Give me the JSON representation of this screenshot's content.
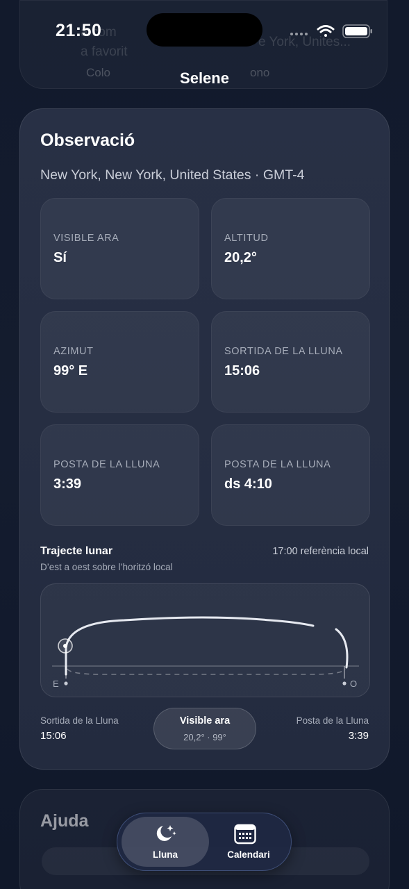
{
  "background_card": {
    "text_a": "a com",
    "text_b": "a favorit",
    "text_c": "e York, Unites..."
  },
  "status_bar": {
    "time": "21:50"
  },
  "nav": {
    "title": "Selene"
  },
  "observation": {
    "title": "Observació",
    "location": "New York, New York, United States · GMT-4",
    "tiles": [
      {
        "label": "VISIBLE ARA",
        "value": "Sí"
      },
      {
        "label": "ALTITUD",
        "value": "20,2°"
      },
      {
        "label": "AZIMUT",
        "value": "99° E"
      },
      {
        "label": "SORTIDA DE LA LLUNA",
        "value": "15:06"
      },
      {
        "label": "POSTA DE LA LLUNA",
        "value": "3:39"
      },
      {
        "label": "POSTA DE LA LLUNA",
        "value": "ds 4:10"
      }
    ],
    "path": {
      "title": "Trajecte lunar",
      "subtitle": "D’est a oest sobre l’horitzó local",
      "reference": "17:00 referència local",
      "east_label": "E",
      "west_label": "O"
    },
    "footer": {
      "rise_label": "Sortida de la Lluna",
      "rise_value": "15:06",
      "now_title": "Visible ara",
      "now_sub": "20,2° · 99°",
      "set_label": "Posta de la Lluna",
      "set_value": "3:39"
    }
  },
  "help": {
    "title": "Ajuda",
    "left_text": "Colo",
    "right_text": "ono"
  },
  "tabbar": {
    "tabs": [
      {
        "label": "Lluna",
        "icon": "moon-stars-icon",
        "active": true
      },
      {
        "label": "Calendari",
        "icon": "calendar-icon",
        "active": false
      }
    ]
  },
  "colors": {
    "background": "#131b2d",
    "card": "#262e43",
    "accent": "#ffffff",
    "muted_text": "#a6acb9"
  }
}
